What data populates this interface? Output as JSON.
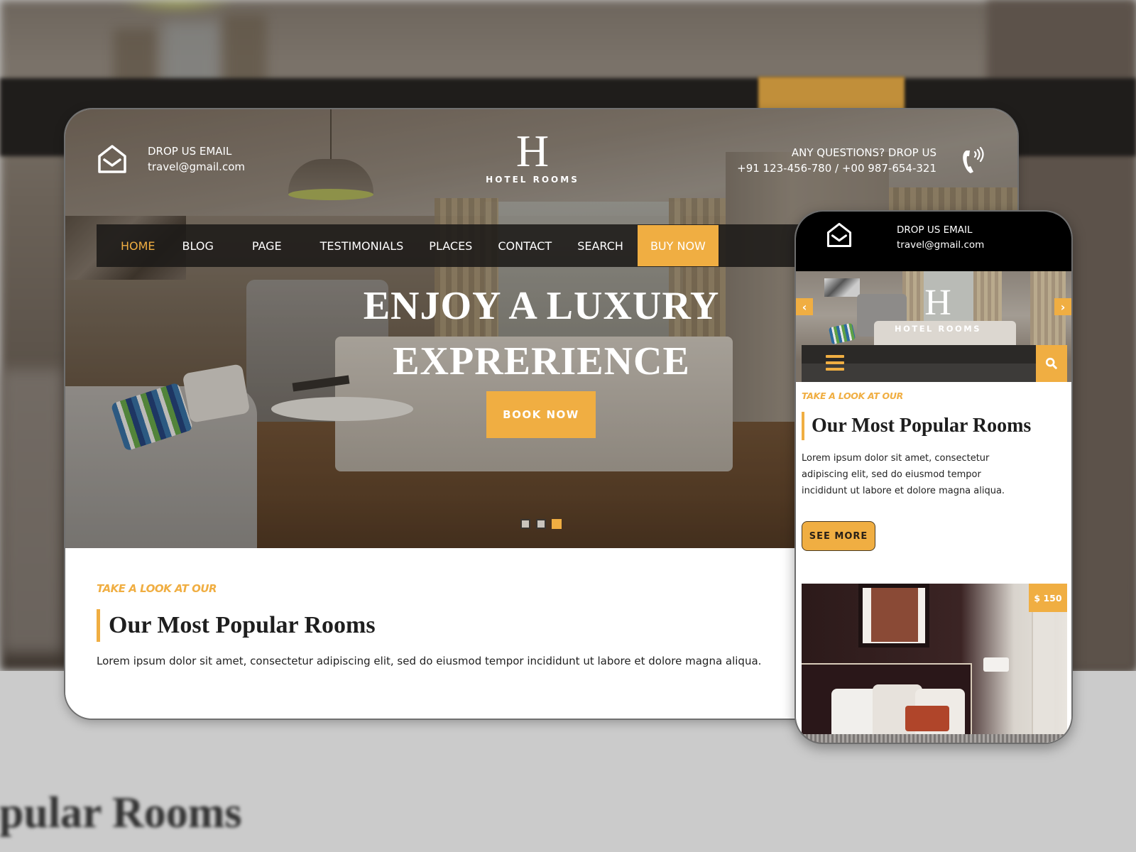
{
  "background": {
    "blurred_title": "Popular Rooms"
  },
  "colors": {
    "accent": "#f0ae42",
    "nav_bg": "#1c1a18",
    "text_dark": "#1e1e1e"
  },
  "desktop": {
    "topbar": {
      "email_label": "DROP US EMAIL",
      "email_value": "travel@gmail.com",
      "email_icon": "envelope-open-icon",
      "phone_label": "ANY QUESTIONS? DROP US",
      "phone_value": "+91 123-456-780 / +00 987-654-321",
      "phone_icon": "phone-ringing-icon"
    },
    "logo": {
      "letter": "H",
      "name": "HOTEL ROOMS"
    },
    "nav": {
      "items": [
        {
          "label": "HOME",
          "active": true
        },
        {
          "label": "BLOG",
          "active": false
        },
        {
          "label": "PAGE",
          "active": false
        },
        {
          "label": "TESTIMONIALS",
          "active": false
        },
        {
          "label": "PLACES",
          "active": false
        },
        {
          "label": "CONTACT",
          "active": false
        },
        {
          "label": "SEARCH",
          "active": false
        }
      ],
      "cta_label": "BUY NOW"
    },
    "hero": {
      "title_line1": "ENJOY A LUXURY",
      "title_line2": "EXPRERIENCE",
      "button_label": "BOOK NOW",
      "slides_total": 3,
      "slide_active": 3
    },
    "section": {
      "eyebrow": "TAKE A LOOK AT OUR",
      "title": "Our Most Popular Rooms",
      "description": "Lorem ipsum dolor sit amet, consectetur adipiscing elit, sed do eiusmod tempor incididunt ut labore et dolore magna aliqua."
    }
  },
  "mobile": {
    "topbar": {
      "email_label": "DROP US EMAIL",
      "email_value": "travel@gmail.com"
    },
    "logo": {
      "letter": "H",
      "name": "HOTEL ROOMS"
    },
    "carousel": {
      "prev_icon": "chevron-left-icon",
      "next_icon": "chevron-right-icon",
      "prev_glyph": "‹",
      "next_glyph": "›"
    },
    "section": {
      "eyebrow": "TAKE A LOOK AT OUR",
      "title": "Our Most Popular Rooms",
      "description": "Lorem ipsum dolor sit amet, consectetur adipiscing elit, sed do eiusmod tempor incididunt ut labore et dolore magna aliqua.",
      "button_label": "SEE MORE"
    },
    "room_card": {
      "price": "$ 150"
    }
  }
}
